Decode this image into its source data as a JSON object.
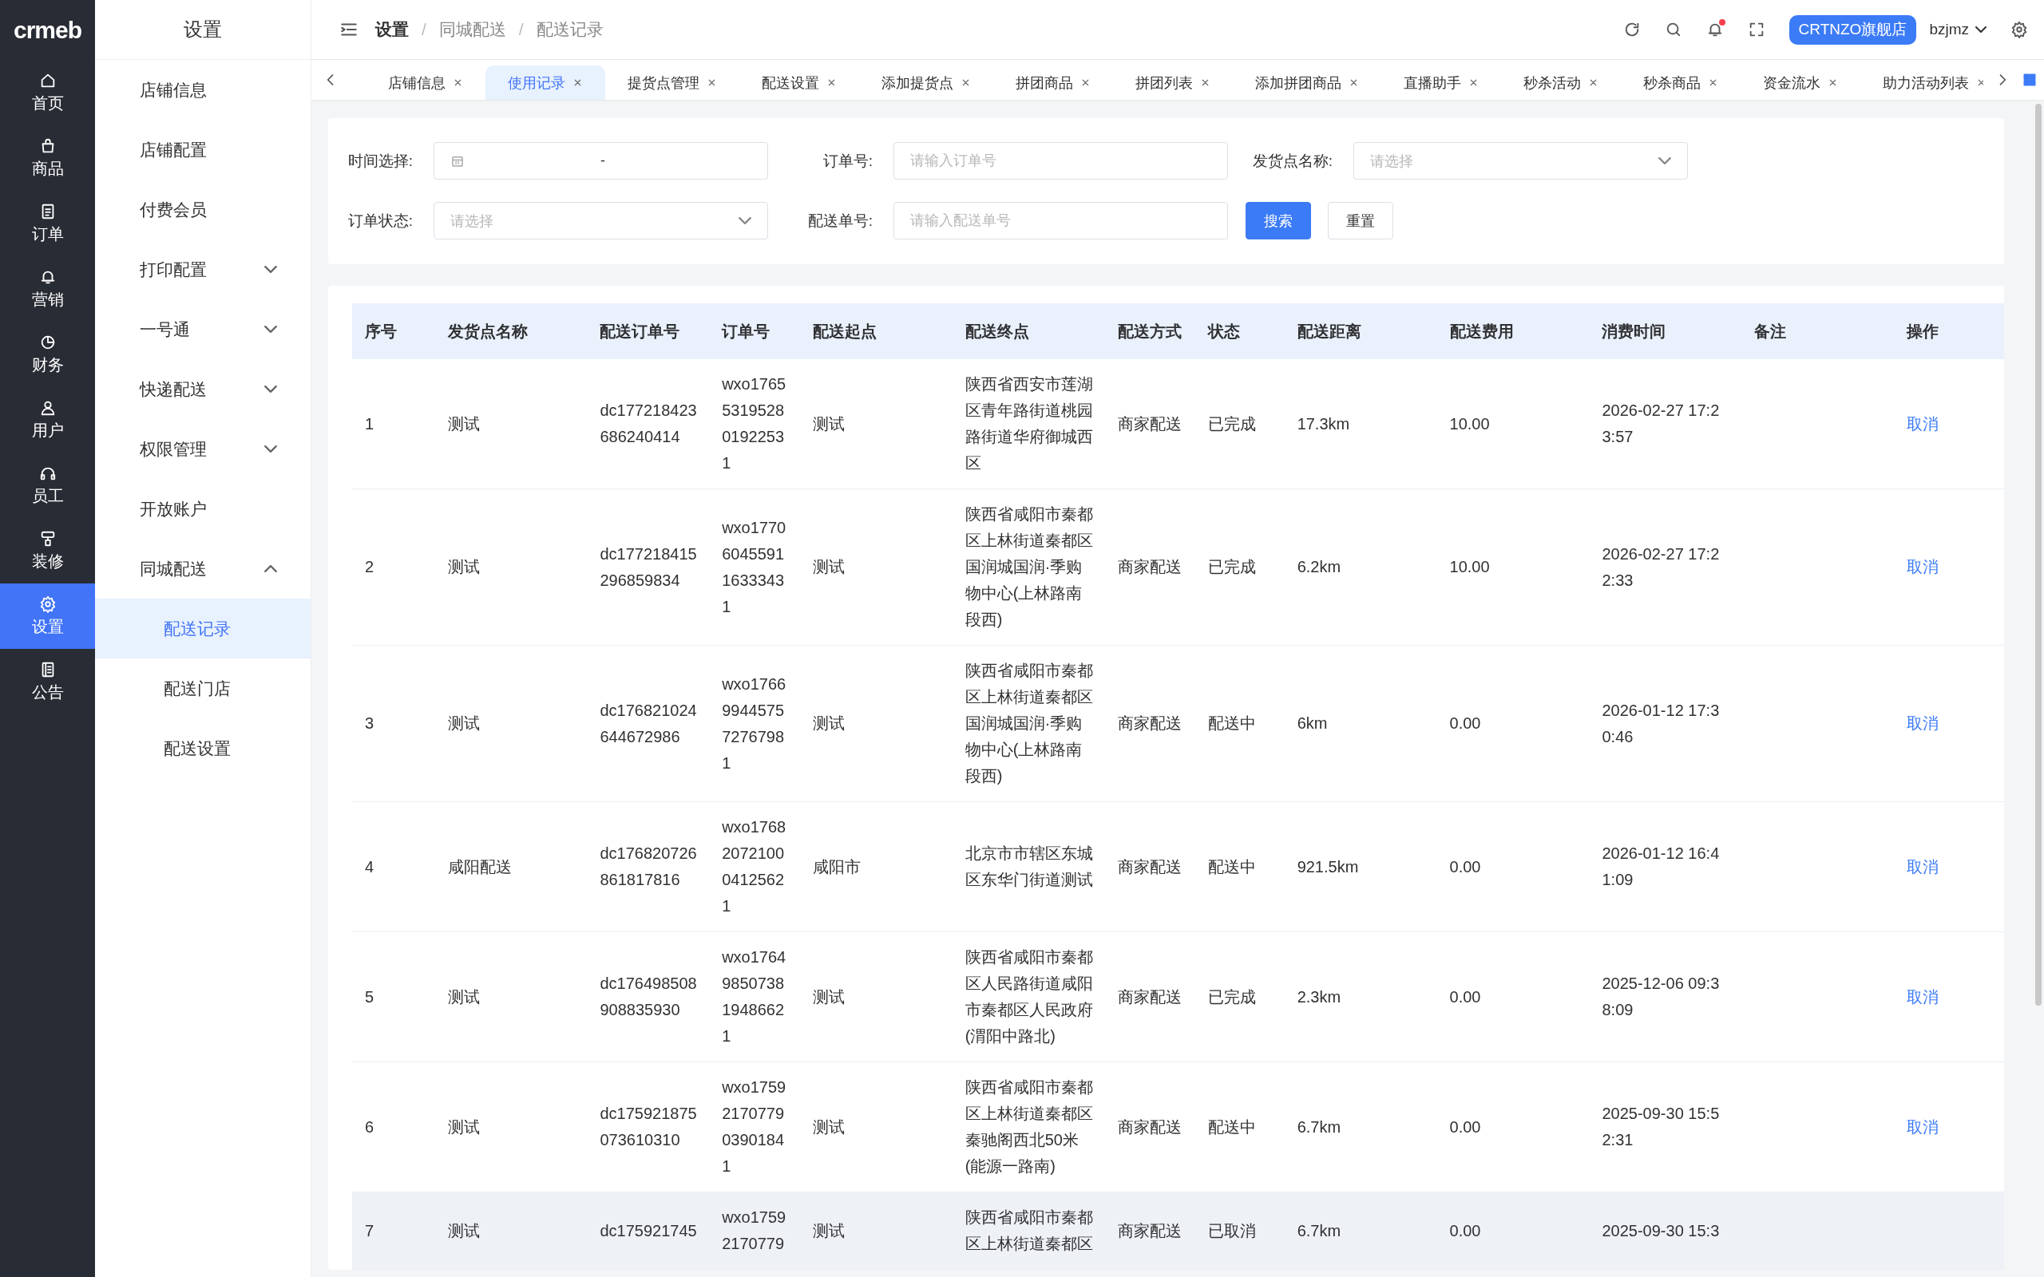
{
  "logo": "crmeb",
  "nav": [
    {
      "label": "首页",
      "selected": false
    },
    {
      "label": "商品",
      "selected": false
    },
    {
      "label": "订单",
      "selected": false
    },
    {
      "label": "营销",
      "selected": false
    },
    {
      "label": "财务",
      "selected": false
    },
    {
      "label": "用户",
      "selected": false
    },
    {
      "label": "员工",
      "selected": false
    },
    {
      "label": "装修",
      "selected": false
    },
    {
      "label": "设置",
      "selected": true
    },
    {
      "label": "公告",
      "selected": false
    }
  ],
  "submenu": {
    "title": "设置",
    "items": [
      {
        "kind": "link",
        "label": "店铺信息",
        "selected": false
      },
      {
        "kind": "link",
        "label": "店铺配置",
        "selected": false
      },
      {
        "kind": "link",
        "label": "付费会员",
        "selected": false
      },
      {
        "kind": "group",
        "label": "打印配置",
        "expanded": false
      },
      {
        "kind": "group",
        "label": "一号通",
        "expanded": false
      },
      {
        "kind": "group",
        "label": "快递配送",
        "expanded": false
      },
      {
        "kind": "group",
        "label": "权限管理",
        "expanded": false
      },
      {
        "kind": "link",
        "label": "开放账户",
        "selected": false
      },
      {
        "kind": "group",
        "label": "同城配送",
        "expanded": true,
        "children": [
          {
            "label": "配送记录",
            "selected": true
          },
          {
            "label": "配送门店",
            "selected": false
          },
          {
            "label": "配送设置",
            "selected": false
          }
        ]
      }
    ]
  },
  "header": {
    "breadcrumb": [
      {
        "label": "设置"
      },
      {
        "separator": "/",
        "label": "同城配送"
      },
      {
        "separator": "/",
        "label": "配送记录"
      }
    ],
    "notification_dot": true,
    "store_button": "CRTNZO旗舰店",
    "user": "bzjmz"
  },
  "tabs": [
    {
      "label": "店铺信息",
      "selected": false
    },
    {
      "label": "使用记录",
      "selected": true
    },
    {
      "label": "提货点管理",
      "selected": false
    },
    {
      "label": "配送设置",
      "selected": false
    },
    {
      "label": "添加提货点",
      "selected": false
    },
    {
      "label": "拼团商品",
      "selected": false
    },
    {
      "label": "拼团列表",
      "selected": false
    },
    {
      "label": "添加拼团商品",
      "selected": false
    },
    {
      "label": "直播助手",
      "selected": false
    },
    {
      "label": "秒杀活动",
      "selected": false
    },
    {
      "label": "秒杀商品",
      "selected": false
    },
    {
      "label": "资金流水",
      "selected": false
    },
    {
      "label": "助力活动列表",
      "selected": false
    }
  ],
  "filters": [
    {
      "kind": "date-range",
      "label": "时间选择:",
      "separator": "-"
    },
    {
      "kind": "input",
      "label": "订单号:",
      "placeholder": "请输入订单号"
    },
    {
      "kind": "select",
      "label": "发货点名称:",
      "placeholder": "请选择"
    },
    {
      "kind": "select",
      "label": "订单状态:",
      "placeholder": "请选择"
    },
    {
      "kind": "input",
      "label": "配送单号:",
      "placeholder": "请输入配送单号"
    }
  ],
  "buttons": [
    {
      "kind": "primary",
      "label": "搜索"
    },
    {
      "kind": "default",
      "label": "重置"
    }
  ],
  "table": {
    "columns": [
      {
        "kind": "text",
        "label": "序号"
      },
      {
        "kind": "text",
        "label": "发货点名称"
      },
      {
        "kind": "text",
        "label": "配送订单号"
      },
      {
        "kind": "text",
        "label": "订单号"
      },
      {
        "kind": "text",
        "label": "配送起点"
      },
      {
        "kind": "text",
        "label": "配送终点"
      },
      {
        "kind": "text",
        "label": "配送方式"
      },
      {
        "kind": "text",
        "label": "状态"
      },
      {
        "kind": "text",
        "label": "配送距离"
      },
      {
        "kind": "text",
        "label": "配送费用"
      },
      {
        "kind": "text",
        "label": "消费时间"
      },
      {
        "kind": "note",
        "label": "备注"
      },
      {
        "kind": "action",
        "label": "操作"
      }
    ],
    "rows": [
      {
        "hovered": false,
        "cells": [
          "1",
          "测试",
          "dc177218423686240414",
          "wxo1765531952801922531",
          "测试",
          "陕西省西安市莲湖区青年路街道桃园路街道华府御城西区",
          "商家配送",
          "已完成",
          "17.3km",
          "10.00",
          "2026-02-27 17:23:57"
        ],
        "action": "取消"
      },
      {
        "hovered": false,
        "cells": [
          "2",
          "测试",
          "dc177218415296859834",
          "wxo1770604559116333431",
          "测试",
          "陕西省咸阳市秦都区上林街道秦都区国润城国润·季购物中心(上林路南段西)",
          "商家配送",
          "已完成",
          "6.2km",
          "10.00",
          "2026-02-27 17:22:33"
        ],
        "action": "取消"
      },
      {
        "hovered": false,
        "cells": [
          "3",
          "测试",
          "dc176821024644672986",
          "wxo1766994457572767981",
          "测试",
          "陕西省咸阳市秦都区上林街道秦都区国润城国润·季购物中心(上林路南段西)",
          "商家配送",
          "配送中",
          "6km",
          "0.00",
          "2026-01-12 17:30:46"
        ],
        "action": "取消"
      },
      {
        "hovered": false,
        "cells": [
          "4",
          "咸阳配送",
          "dc176820726861817816",
          "wxo1768207210004125621",
          "咸阳市",
          "北京市市辖区东城区东华门街道测试",
          "商家配送",
          "配送中",
          "921.5km",
          "0.00",
          "2026-01-12 16:41:09"
        ],
        "action": "取消"
      },
      {
        "hovered": false,
        "cells": [
          "5",
          "测试",
          "dc176498508908835930",
          "wxo1764985073819486621",
          "测试",
          "陕西省咸阳市秦都区人民路街道咸阳市秦都区人民政府(渭阳中路北)",
          "商家配送",
          "已完成",
          "2.3km",
          "0.00",
          "2025-12-06 09:38:09"
        ],
        "action": "取消"
      },
      {
        "hovered": false,
        "cells": [
          "6",
          "测试",
          "dc175921875073610310",
          "wxo1759217077903901841",
          "测试",
          "陕西省咸阳市秦都区上林街道秦都区秦驰阁西北50米(能源一路南)",
          "商家配送",
          "配送中",
          "6.7km",
          "0.00",
          "2025-09-30 15:52:31"
        ],
        "action": "取消"
      },
      {
        "hovered": true,
        "cells": [
          "7",
          "测试",
          "dc175921745",
          "wxo17592170779",
          "测试",
          "陕西省咸阳市秦都区上林街道秦都区",
          "商家配送",
          "已取消",
          "6.7km",
          "0.00",
          "2025-09-30 15:3"
        ]
      }
    ]
  }
}
